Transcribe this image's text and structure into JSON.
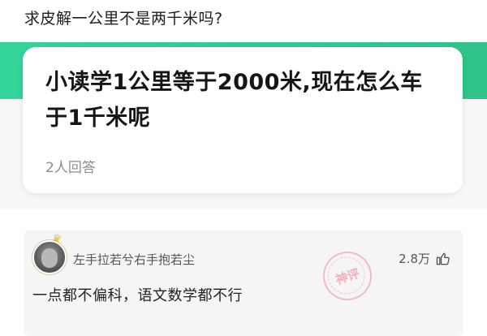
{
  "header": {
    "title": "求皮解一公里不是两千米吗?"
  },
  "question": {
    "text": "小读学1公里等于2000米,现在怎么车于1千米呢",
    "answer_count": "2人回答"
  },
  "comment": {
    "username": "左手拉若兮右手抱若尘",
    "likes": "2.8万",
    "text": "一点都不偏科，语文数学都不行",
    "stamp_text": "神评"
  },
  "icons": {
    "thumb": "thumbs-up-icon",
    "crown": "crown-icon",
    "avatar": "user-avatar"
  },
  "colors": {
    "accent_green": "#33d49a",
    "stamp_pink": "#ec788c"
  }
}
